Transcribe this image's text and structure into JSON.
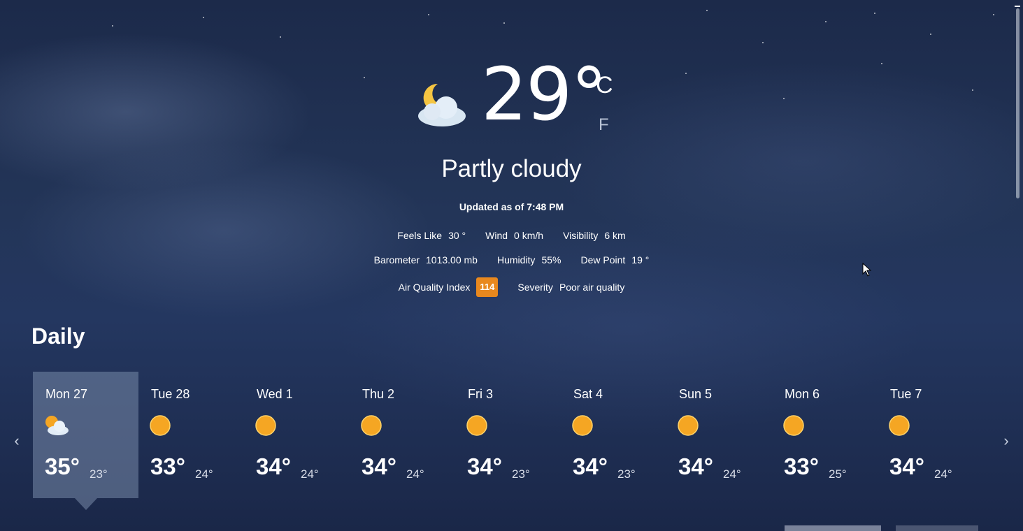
{
  "current": {
    "temperature": "29°",
    "unit_celsius": "C",
    "unit_fahrenheit": "F",
    "icon": "partly-cloudy-night-icon",
    "condition": "Partly cloudy",
    "updated": "Updated as of 7:48 PM"
  },
  "details": {
    "feels_like": {
      "label": "Feels Like",
      "value": "30 °"
    },
    "wind": {
      "label": "Wind",
      "value": "0 km/h"
    },
    "visibility": {
      "label": "Visibility",
      "value": "6 km"
    },
    "barometer": {
      "label": "Barometer",
      "value": "1013.00 mb"
    },
    "humidity": {
      "label": "Humidity",
      "value": "55%"
    },
    "dew_point": {
      "label": "Dew Point",
      "value": "19 °"
    },
    "aqi": {
      "label": "Air Quality Index",
      "value": "114"
    },
    "severity": {
      "label": "Severity",
      "value": "Poor air quality"
    }
  },
  "daily": {
    "title": "Daily",
    "days": [
      {
        "name": "Mon 27",
        "icon": "partly-cloudy-icon",
        "hi": "35°",
        "lo": "23°",
        "selected": true
      },
      {
        "name": "Tue 28",
        "icon": "sunny-icon",
        "hi": "33°",
        "lo": "24°"
      },
      {
        "name": "Wed 1",
        "icon": "sunny-icon",
        "hi": "34°",
        "lo": "24°"
      },
      {
        "name": "Thu 2",
        "icon": "sunny-icon",
        "hi": "34°",
        "lo": "24°"
      },
      {
        "name": "Fri 3",
        "icon": "sunny-icon",
        "hi": "34°",
        "lo": "23°"
      },
      {
        "name": "Sat 4",
        "icon": "sunny-icon",
        "hi": "34°",
        "lo": "23°"
      },
      {
        "name": "Sun 5",
        "icon": "sunny-icon",
        "hi": "34°",
        "lo": "24°"
      },
      {
        "name": "Mon 6",
        "icon": "sunny-icon",
        "hi": "33°",
        "lo": "25°"
      },
      {
        "name": "Tue 7",
        "icon": "sunny-icon",
        "hi": "34°",
        "lo": "24°"
      }
    ]
  },
  "colors": {
    "aqi_badge": "#e8881e",
    "sun": "#f5a623"
  }
}
